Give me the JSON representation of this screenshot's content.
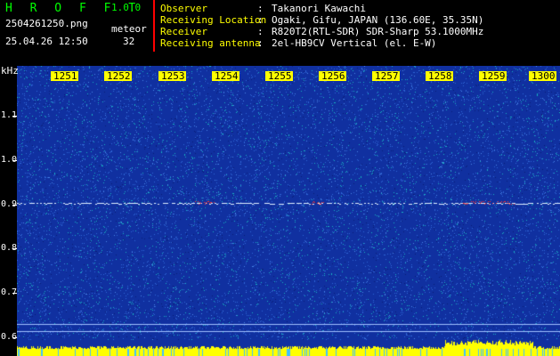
{
  "app": {
    "title": "H R O F F T",
    "version": "1.0.0",
    "filename": "2504261250.png",
    "datetime": "25.04.26 12:50",
    "mode": "meteor",
    "count": "32"
  },
  "meta": [
    {
      "label": "Observer",
      "value": "Takanori Kawachi"
    },
    {
      "label": "Receiving Location",
      "value": "Ogaki, Gifu, JAPAN (136.60E, 35.35N)"
    },
    {
      "label": "Receiver",
      "value": "R820T2(RTL-SDR) SDR-Sharp 53.1000MHz"
    },
    {
      "label": "Receiving antenna",
      "value": "2el-HB9CV Vertical (el. E-W)"
    }
  ],
  "meta_separator": ":",
  "axis": {
    "y_unit": "kHz",
    "y_ticks": [
      "1.1",
      "1.0",
      "0.9",
      "0.8",
      "0.7",
      "0.6"
    ],
    "x_ticks": [
      "1251",
      "1252",
      "1253",
      "1254",
      "1255",
      "1256",
      "1257",
      "1258",
      "1259",
      "1300"
    ]
  },
  "colors": {
    "background": "#000000",
    "noise_base": "#1030a0",
    "noise_mid": "#2f66d6",
    "noise_high": "#18b0c0",
    "signal": "#ff3030",
    "carrier": "#e0f0ff",
    "tick_yellow": "#ffff00"
  }
}
